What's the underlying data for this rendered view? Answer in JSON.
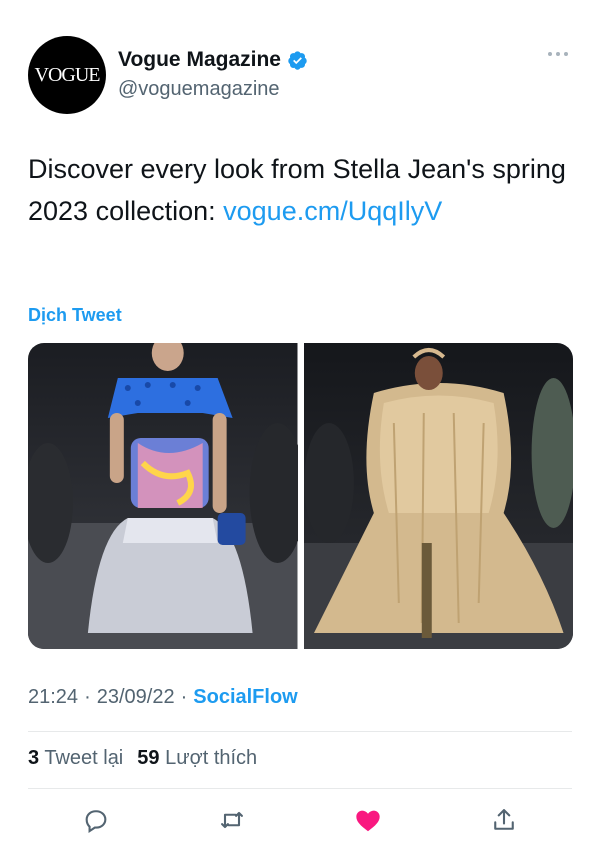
{
  "author": {
    "avatar_text": "VOGUE",
    "display_name": "Vogue Magazine",
    "handle": "@voguemagazine",
    "verified": true
  },
  "tweet": {
    "text_before_link": "Discover every look from Stella Jean's spring 2023 collection: ",
    "link_text": "vogue.cm/UqqIlyV",
    "translate_label": "Dịch Tweet"
  },
  "media": [
    {
      "icon": "runway-photo-left"
    },
    {
      "icon": "runway-photo-right"
    }
  ],
  "meta": {
    "time": "21:24",
    "separator": "·",
    "date": "23/09/22",
    "source": "SocialFlow"
  },
  "stats": {
    "retweets_count": "3",
    "retweets_label": "Tweet lại",
    "likes_count": "59",
    "likes_label": "Lượt thích"
  },
  "actions": {
    "reply_icon": "reply-icon",
    "retweet_icon": "retweet-icon",
    "like_icon": "heart-icon",
    "share_icon": "share-icon",
    "like_color": "#f91880"
  },
  "colors": {
    "accent": "#1d9bf0",
    "secondary_text": "#536471",
    "primary_text": "#0f1419"
  }
}
